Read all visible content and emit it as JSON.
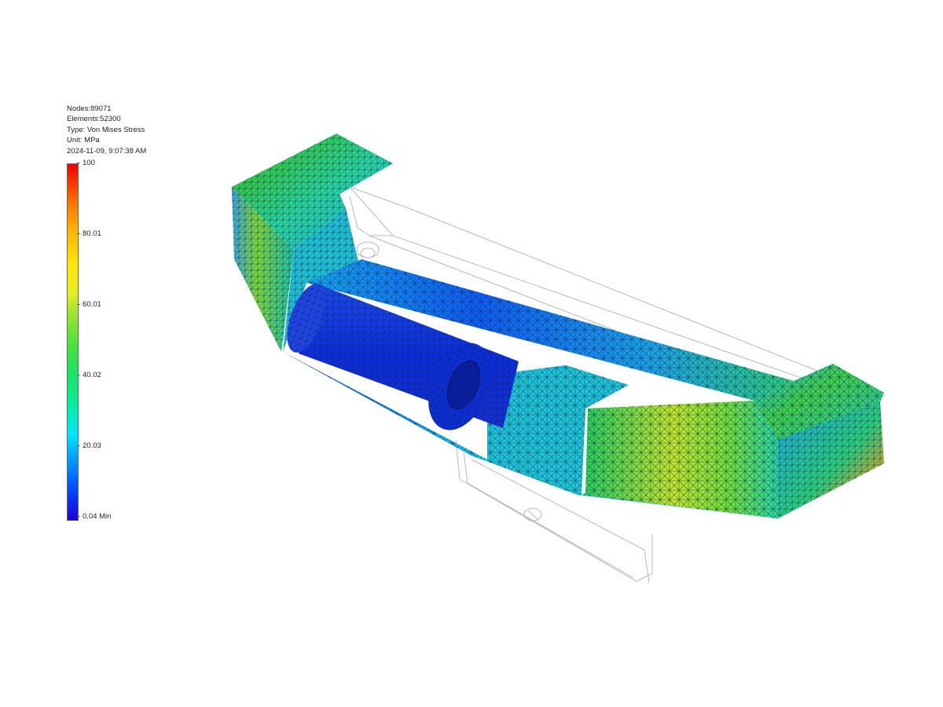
{
  "info": {
    "nodes": "Nodes:89071",
    "elements": "Elements:52300",
    "type": "Type: Von Mises Stress",
    "unit": "Unit: MPa",
    "timestamp": "2024-11-09, 9:07:38 AM"
  },
  "legend": {
    "ticks": [
      {
        "label": "100",
        "value": 100
      },
      {
        "label": "80.01",
        "value": 80.01
      },
      {
        "label": "60.01",
        "value": 60.01
      },
      {
        "label": "40.02",
        "value": 40.02
      },
      {
        "label": "20.03",
        "value": 20.03
      },
      {
        "label": "0.04 Min",
        "value": 0.04
      }
    ],
    "colors": {
      "max": "#f10000",
      "high": "#ffb000",
      "mid_high": "#e6ee20",
      "mid": "#1ce35d",
      "mid_low": "#00e5ff",
      "low": "#0046ff",
      "min": "#1f00d8"
    }
  },
  "model": {
    "mesh_color": "#10204a",
    "ghost_outline_color": "#b8b8b8"
  }
}
